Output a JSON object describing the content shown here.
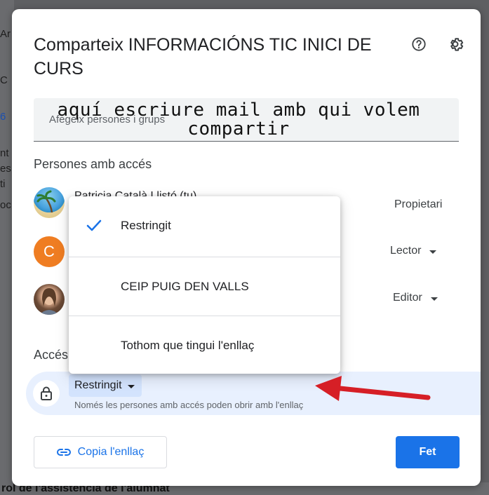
{
  "background": {
    "left_fragments": [
      "Ar",
      "C",
      "6",
      "nt",
      "es",
      "ti",
      "oc"
    ],
    "bottom_text": "rol de l'assistència de l'alumnat"
  },
  "dialog": {
    "title": "Comparteix INFORMACIÓNS TIC INICI DE CURS",
    "help_icon": "help-circle-icon",
    "settings_icon": "gear-icon",
    "add_people": {
      "placeholder": "Afegeix persones i grups",
      "handwritten_note": "aquí escriure mail amb qui volem compartir"
    },
    "people_section_label": "Persones amb accés",
    "people": [
      {
        "name": "Patricia Català Llistó (tu)",
        "role": "Propietari",
        "avatar": "beach-photo"
      },
      {
        "name": "",
        "initial": "C",
        "role": "Lector",
        "avatar_color": "#ef7d22"
      },
      {
        "name": "",
        "role": "Editor",
        "avatar": "profile-photo"
      }
    ],
    "general_access_label": "Accés general",
    "general_access": {
      "value": "Restringit",
      "description": "Només les persones amb accés poden obrir amb l'enllaç"
    },
    "copy_link_label": "Copia l'enllaç",
    "done_label": "Fet",
    "dropdown_options": [
      {
        "label": "Restringit",
        "selected": true
      },
      {
        "label": "CEIP PUIG DEN VALLS",
        "selected": false
      },
      {
        "label": "Tothom que tingui l'enllaç",
        "selected": false
      }
    ]
  },
  "colors": {
    "accent": "#1a73e8",
    "annotation_arrow": "#d61f26",
    "access_row_bg": "#e8f0fe"
  }
}
